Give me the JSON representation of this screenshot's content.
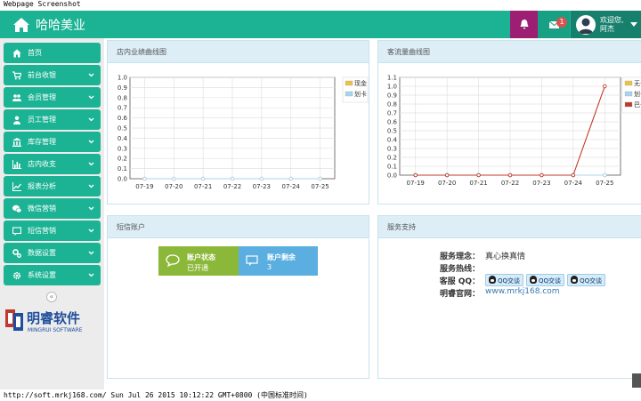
{
  "window_title": "Webpage Screenshot",
  "brand": {
    "title": "哈哈美业"
  },
  "header": {
    "mail_badge": "1",
    "user_line1": "欢迎您,",
    "user_line2": "阿杰"
  },
  "sidebar": {
    "items": [
      {
        "label": "首页",
        "icon": "home-icon",
        "has_arrow": false
      },
      {
        "label": "前台收银",
        "icon": "cart-icon",
        "has_arrow": true
      },
      {
        "label": "会员管理",
        "icon": "users-icon",
        "has_arrow": true
      },
      {
        "label": "员工管理",
        "icon": "user-icon",
        "has_arrow": true
      },
      {
        "label": "库存管理",
        "icon": "bank-icon",
        "has_arrow": true
      },
      {
        "label": "店内收支",
        "icon": "bar-chart-icon",
        "has_arrow": true
      },
      {
        "label": "报表分析",
        "icon": "line-chart-icon",
        "has_arrow": true
      },
      {
        "label": "微信营销",
        "icon": "wechat-icon",
        "has_arrow": true
      },
      {
        "label": "短信营销",
        "icon": "sms-icon",
        "has_arrow": true
      },
      {
        "label": "数据设置",
        "icon": "cogs-icon",
        "has_arrow": true
      },
      {
        "label": "系统设置",
        "icon": "gear-icon",
        "has_arrow": true
      }
    ],
    "collapse_glyph": "«",
    "logo_text": "明睿软件",
    "logo_sub": "MINGRUI SOFTWARE"
  },
  "panels": {
    "sales_title": "店内业绩曲线图",
    "traffic_title": "客流量曲线图",
    "sms_title": "短信账户",
    "support_title": "服务支持"
  },
  "sms": {
    "status_label": "账户状态",
    "status_value": "已开通",
    "remain_label": "账户剩余",
    "remain_value": "3"
  },
  "support": {
    "concept_label": "服务理念：",
    "concept_value": "真心换真情",
    "hotline_label": "服务热线：",
    "hotline_value": "",
    "qq_label": "客服 QQ：",
    "qq_buttons": [
      "QQ交谈",
      "QQ交谈",
      "QQ交谈"
    ],
    "site_label": "明睿官网：",
    "site_value": "www.mrkj168.com"
  },
  "status_bar": "http://soft.mrkj168.com/ Sun Jul 26 2015 10:12:22 GMT+0800 (中国标准时间)",
  "chart_data": [
    {
      "type": "line",
      "title": "店内业绩曲线图",
      "categories": [
        "07-19",
        "07-20",
        "07-21",
        "07-22",
        "07-23",
        "07-24",
        "07-25"
      ],
      "ylim": [
        0,
        1.0
      ],
      "yticks": [
        "0.0",
        "0.1",
        "0.2",
        "0.3",
        "0.4",
        "0.5",
        "0.6",
        "0.7",
        "0.8",
        "0.9",
        "1.0"
      ],
      "series": [
        {
          "name": "现金",
          "color": "#f0c040",
          "values": [
            0,
            0,
            0,
            0,
            0,
            0,
            0
          ]
        },
        {
          "name": "划卡",
          "color": "#a8d4ee",
          "values": [
            0,
            0,
            0,
            0,
            0,
            0,
            0
          ]
        }
      ],
      "legend": "top-right",
      "grid": true
    },
    {
      "type": "line",
      "title": "客流量曲线图",
      "categories": [
        "07-19",
        "07-20",
        "07-21",
        "07-22",
        "07-23",
        "07-24",
        "07-25"
      ],
      "ylim": [
        0,
        1.1
      ],
      "yticks": [
        "0.0",
        "0.1",
        "0.2",
        "0.3",
        "0.4",
        "0.5",
        "0.6",
        "0.7",
        "0.8",
        "0.9",
        "1.0",
        "1.1"
      ],
      "series": [
        {
          "name": "无卡",
          "color": "#f0c040",
          "values": [
            0,
            0,
            0,
            0,
            0,
            0,
            0
          ]
        },
        {
          "name": "划卡",
          "color": "#a8d4ee",
          "values": [
            0,
            0,
            0,
            0,
            0,
            0,
            0
          ]
        },
        {
          "name": "巴卡",
          "color": "#c0392b",
          "values": [
            0,
            0,
            0,
            0,
            0,
            0,
            1
          ]
        }
      ],
      "legend": "top-right",
      "grid": true
    }
  ]
}
